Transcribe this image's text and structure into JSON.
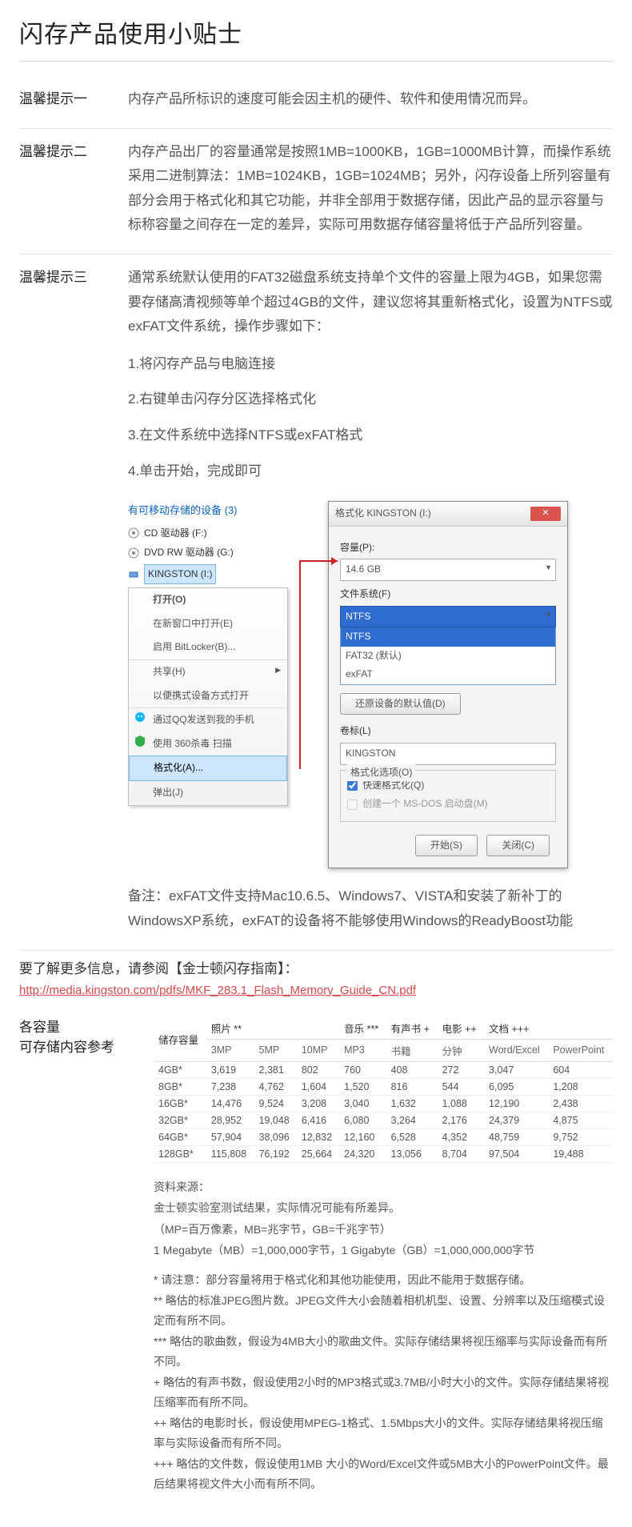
{
  "title": "闪存产品使用小贴士",
  "tips": [
    {
      "label": "温馨提示一",
      "body": "内存产品所标识的速度可能会因主机的硬件、软件和使用情况而异。"
    },
    {
      "label": "温馨提示二",
      "body": "内存产品出厂的容量通常是按照1MB=1000KB，1GB=1000MB计算，而操作系统采用二进制算法：1MB=1024KB，1GB=1024MB；另外，闪存设备上所列容量有部分会用于格式化和其它功能，并非全部用于数据存储，因此产品的显示容量与标称容量之间存在一定的差异，实际可用数据存储容量将低于产品所列容量。"
    },
    {
      "label": "温馨提示三",
      "intro": "通常系统默认使用的FAT32磁盘系统支持单个文件的容量上限为4GB，如果您需要存储高清视频等单个超过4GB的文件，建议您将其重新格式化，设置为NTFS或exFAT文件系统，操作步骤如下：",
      "steps": [
        "1.将闪存产品与电脑连接",
        "2.右键单击闪存分区选择格式化",
        "3.在文件系统中选择NTFS或exFAT格式",
        "4.单击开始，完成即可"
      ],
      "note": "备注：exFAT文件支持Mac10.6.5、Windows7、VISTA和安装了新补丁的WindowsXP系统，exFAT的设备将不能够使用Windows的ReadyBoost功能"
    }
  ],
  "explorer": {
    "heading": "有可移动存储的设备 (3)",
    "drives": [
      {
        "name": "CD 驱动器 (F:)",
        "icon": "cd"
      },
      {
        "name": "DVD RW 驱动器 (G:)",
        "icon": "dvd"
      },
      {
        "name": "KINGSTON (I:)",
        "icon": "usb",
        "selected": true
      }
    ],
    "ctx": [
      {
        "t": "打开(O)"
      },
      {
        "t": "在新窗口中打开(E)"
      },
      {
        "t": "启用 BitLocker(B)..."
      },
      {
        "t": "共享(H)",
        "arrow": true,
        "sep": true
      },
      {
        "t": "以便携式设备方式打开"
      },
      {
        "t": "通过QQ发送到我的手机",
        "icon": "qq",
        "sep": true
      },
      {
        "t": "使用 360杀毒 扫描",
        "icon": "360"
      },
      {
        "t": "格式化(A)...",
        "hl": true,
        "sep": true
      },
      {
        "t": "弹出(J)"
      }
    ]
  },
  "dialog": {
    "title": "格式化 KINGSTON (I:)",
    "cap_label": "容量(P):",
    "cap_value": "14.6 GB",
    "fs_label": "文件系统(F)",
    "fs_selected": "NTFS",
    "fs_list": [
      "NTFS",
      "FAT32 (默认)",
      "exFAT"
    ],
    "restore_btn": "还原设备的默认值(D)",
    "vol_label": "卷标(L)",
    "vol_value": "KINGSTON",
    "opt_label": "格式化选项(O)",
    "opt_quick": "快速格式化(Q)",
    "opt_dos": "创建一个 MS-DOS 启动盘(M)",
    "btn_start": "开始(S)",
    "btn_close": "关闭(C)"
  },
  "more": {
    "lead": "要了解更多信息，请参阅【金士顿闪存指南】：",
    "link": "http://media.kingston.com/pdfs/MKF_283.1_Flash_Memory_Guide_CN.pdf"
  },
  "capacity": {
    "label_l1": "各容量",
    "label_l2": "可存储内容参考",
    "group_headers": [
      "照片 **",
      "音乐 ***",
      "有声书 +",
      "电影 ++",
      "文档 +++"
    ],
    "col_storage": "储存容量",
    "cols": [
      "3MP",
      "5MP",
      "10MP",
      "MP3",
      "书籍",
      "分钟",
      "Word/Excel",
      "PowerPoint"
    ],
    "rows": [
      {
        "cap": "4GB*",
        "v": [
          "3,619",
          "2,381",
          "802",
          "760",
          "408",
          "272",
          "3,047",
          "604"
        ]
      },
      {
        "cap": "8GB*",
        "v": [
          "7,238",
          "4,762",
          "1,604",
          "1,520",
          "816",
          "544",
          "6,095",
          "1,208"
        ]
      },
      {
        "cap": "16GB*",
        "v": [
          "14,476",
          "9,524",
          "3,208",
          "3,040",
          "1,632",
          "1,088",
          "12,190",
          "2,438"
        ]
      },
      {
        "cap": "32GB*",
        "v": [
          "28,952",
          "19,048",
          "6,416",
          "6,080",
          "3,264",
          "2,176",
          "24,379",
          "4,875"
        ]
      },
      {
        "cap": "64GB*",
        "v": [
          "57,904",
          "38,096",
          "12,832",
          "12,160",
          "6,528",
          "4,352",
          "48,759",
          "9,752"
        ]
      },
      {
        "cap": "128GB*",
        "v": [
          "115,808",
          "76,192",
          "25,664",
          "24,320",
          "13,056",
          "8,704",
          "97,504",
          "19,488"
        ]
      }
    ],
    "sources": [
      "资料来源：",
      "金士顿实验室测试结果，实际情况可能有所差异。",
      "（MP=百万像素，MB=兆字节，GB=千兆字节）",
      "1 Megabyte（MB）=1,000,000字节，1 Gigabyte（GB）=1,000,000,000字节",
      "",
      "* 请注意：部分容量将用于格式化和其他功能使用，因此不能用于数据存储。",
      "** 略估的标准JPEG图片数。JPEG文件大小会随着相机机型、设置、分辨率以及压缩模式设定而有所不同。",
      "*** 略估的歌曲数，假设为4MB大小的歌曲文件。实际存储结果将视压缩率与实际设备而有所不同。",
      "+ 略估的有声书数，假设使用2小时的MP3格式或3.7MB/小时大小的文件。实际存储结果将视压缩率而有所不同。",
      "++ 略估的电影时长，假设使用MPEG-1格式、1.5Mbps大小的文件。实际存储结果将视压缩率与实际设备而有所不同。",
      "+++ 略估的文件数，假设使用1MB 大小的Word/Excel文件或5MB大小的PowerPoint文件。最后结果将视文件大小而有所不同。"
    ]
  }
}
